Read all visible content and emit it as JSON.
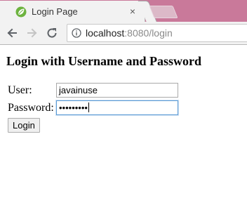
{
  "browser": {
    "tab": {
      "title": "Login Page",
      "close_glyph": "×",
      "favicon": "spring-leaf-icon"
    },
    "toolbar": {
      "back_icon": "back-arrow-icon",
      "forward_icon": "forward-arrow-icon",
      "reload_icon": "reload-icon",
      "info_icon": "info-icon",
      "url_host": "localhost",
      "url_rest": ":8080/login"
    },
    "colors": {
      "tabstrip": "#c9799a",
      "toolbar": "#f2f2f2",
      "favicon": "#6db33f",
      "focus_border": "#5b9bd5"
    }
  },
  "page": {
    "heading": "Login with Username and Password",
    "form": {
      "username_label": "User:",
      "username_value": "javainuse",
      "password_label": "Password:",
      "password_masked": "•••••••••",
      "submit_label": "Login"
    }
  }
}
